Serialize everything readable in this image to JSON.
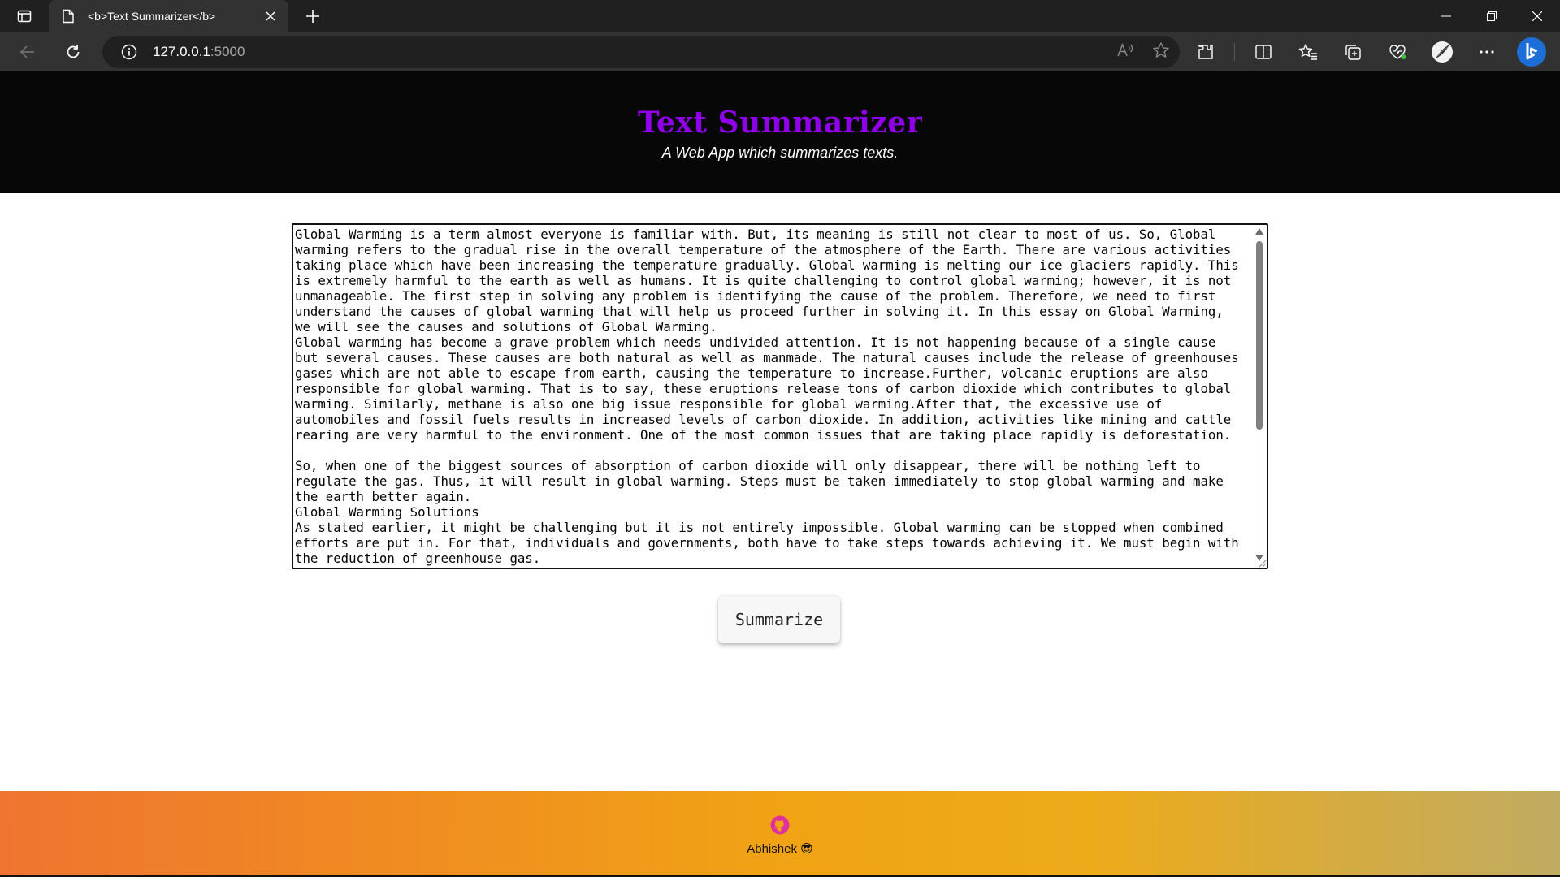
{
  "browser": {
    "tab_title": "<b>Text Summarizer</b>",
    "url_host": "127.0.0.1",
    "url_port": ":5000"
  },
  "header": {
    "title": "Text Summarizer",
    "subtitle": "A Web App which summarizes texts."
  },
  "main": {
    "input_text": "Global Warming is a term almost everyone is familiar with. But, its meaning is still not clear to most of us. So, Global warming refers to the gradual rise in the overall temperature of the atmosphere of the Earth. There are various activities taking place which have been increasing the temperature gradually. Global warming is melting our ice glaciers rapidly. This is extremely harmful to the earth as well as humans. It is quite challenging to control global warming; however, it is not unmanageable. The first step in solving any problem is identifying the cause of the problem. Therefore, we need to first understand the causes of global warming that will help us proceed further in solving it. In this essay on Global Warming, we will see the causes and solutions of Global Warming.\nGlobal warming has become a grave problem which needs undivided attention. It is not happening because of a single cause but several causes. These causes are both natural as well as manmade. The natural causes include the release of greenhouses gases which are not able to escape from earth, causing the temperature to increase.Further, volcanic eruptions are also responsible for global warming. That is to say, these eruptions release tons of carbon dioxide which contributes to global warming. Similarly, methane is also one big issue responsible for global warming.After that, the excessive use of automobiles and fossil fuels results in increased levels of carbon dioxide. In addition, activities like mining and cattle rearing are very harmful to the environment. One of the most common issues that are taking place rapidly is deforestation.\n\nSo, when one of the biggest sources of absorption of carbon dioxide will only disappear, there will be nothing left to regulate the gas. Thus, it will result in global warming. Steps must be taken immediately to stop global warming and make the earth better again.\nGlobal Warming Solutions\nAs stated earlier, it might be challenging but it is not entirely impossible. Global warming can be stopped when combined efforts are put in. For that, individuals and governments, both have to take steps towards achieving it. We must begin with the reduction of greenhouse gas.",
    "summarize_label": "Summarize"
  },
  "footer": {
    "author": "Abhishek 😎"
  },
  "colors": {
    "title_purple": "#8f00e8",
    "header_bg": "#070708",
    "footer_gradient_start": "#ef7430",
    "footer_gradient_end": "#c0ab62",
    "github_icon": "#e0309a"
  }
}
